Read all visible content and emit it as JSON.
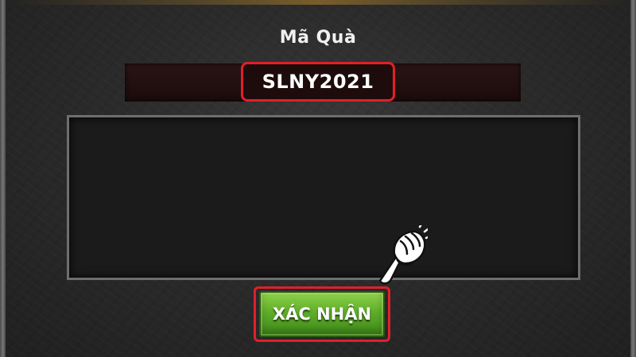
{
  "dialog": {
    "title": "Mã Quà",
    "code_value": "SLNY2021",
    "message": "",
    "confirm_label": "XÁC NHẬN"
  },
  "colors": {
    "highlight_red": "#e0202a",
    "button_green": "#5fae2a",
    "code_bar_bg": "#2a1414",
    "panel_border": "#6e6e6e"
  },
  "icons": {
    "pointer": "pointing-hand-icon"
  }
}
